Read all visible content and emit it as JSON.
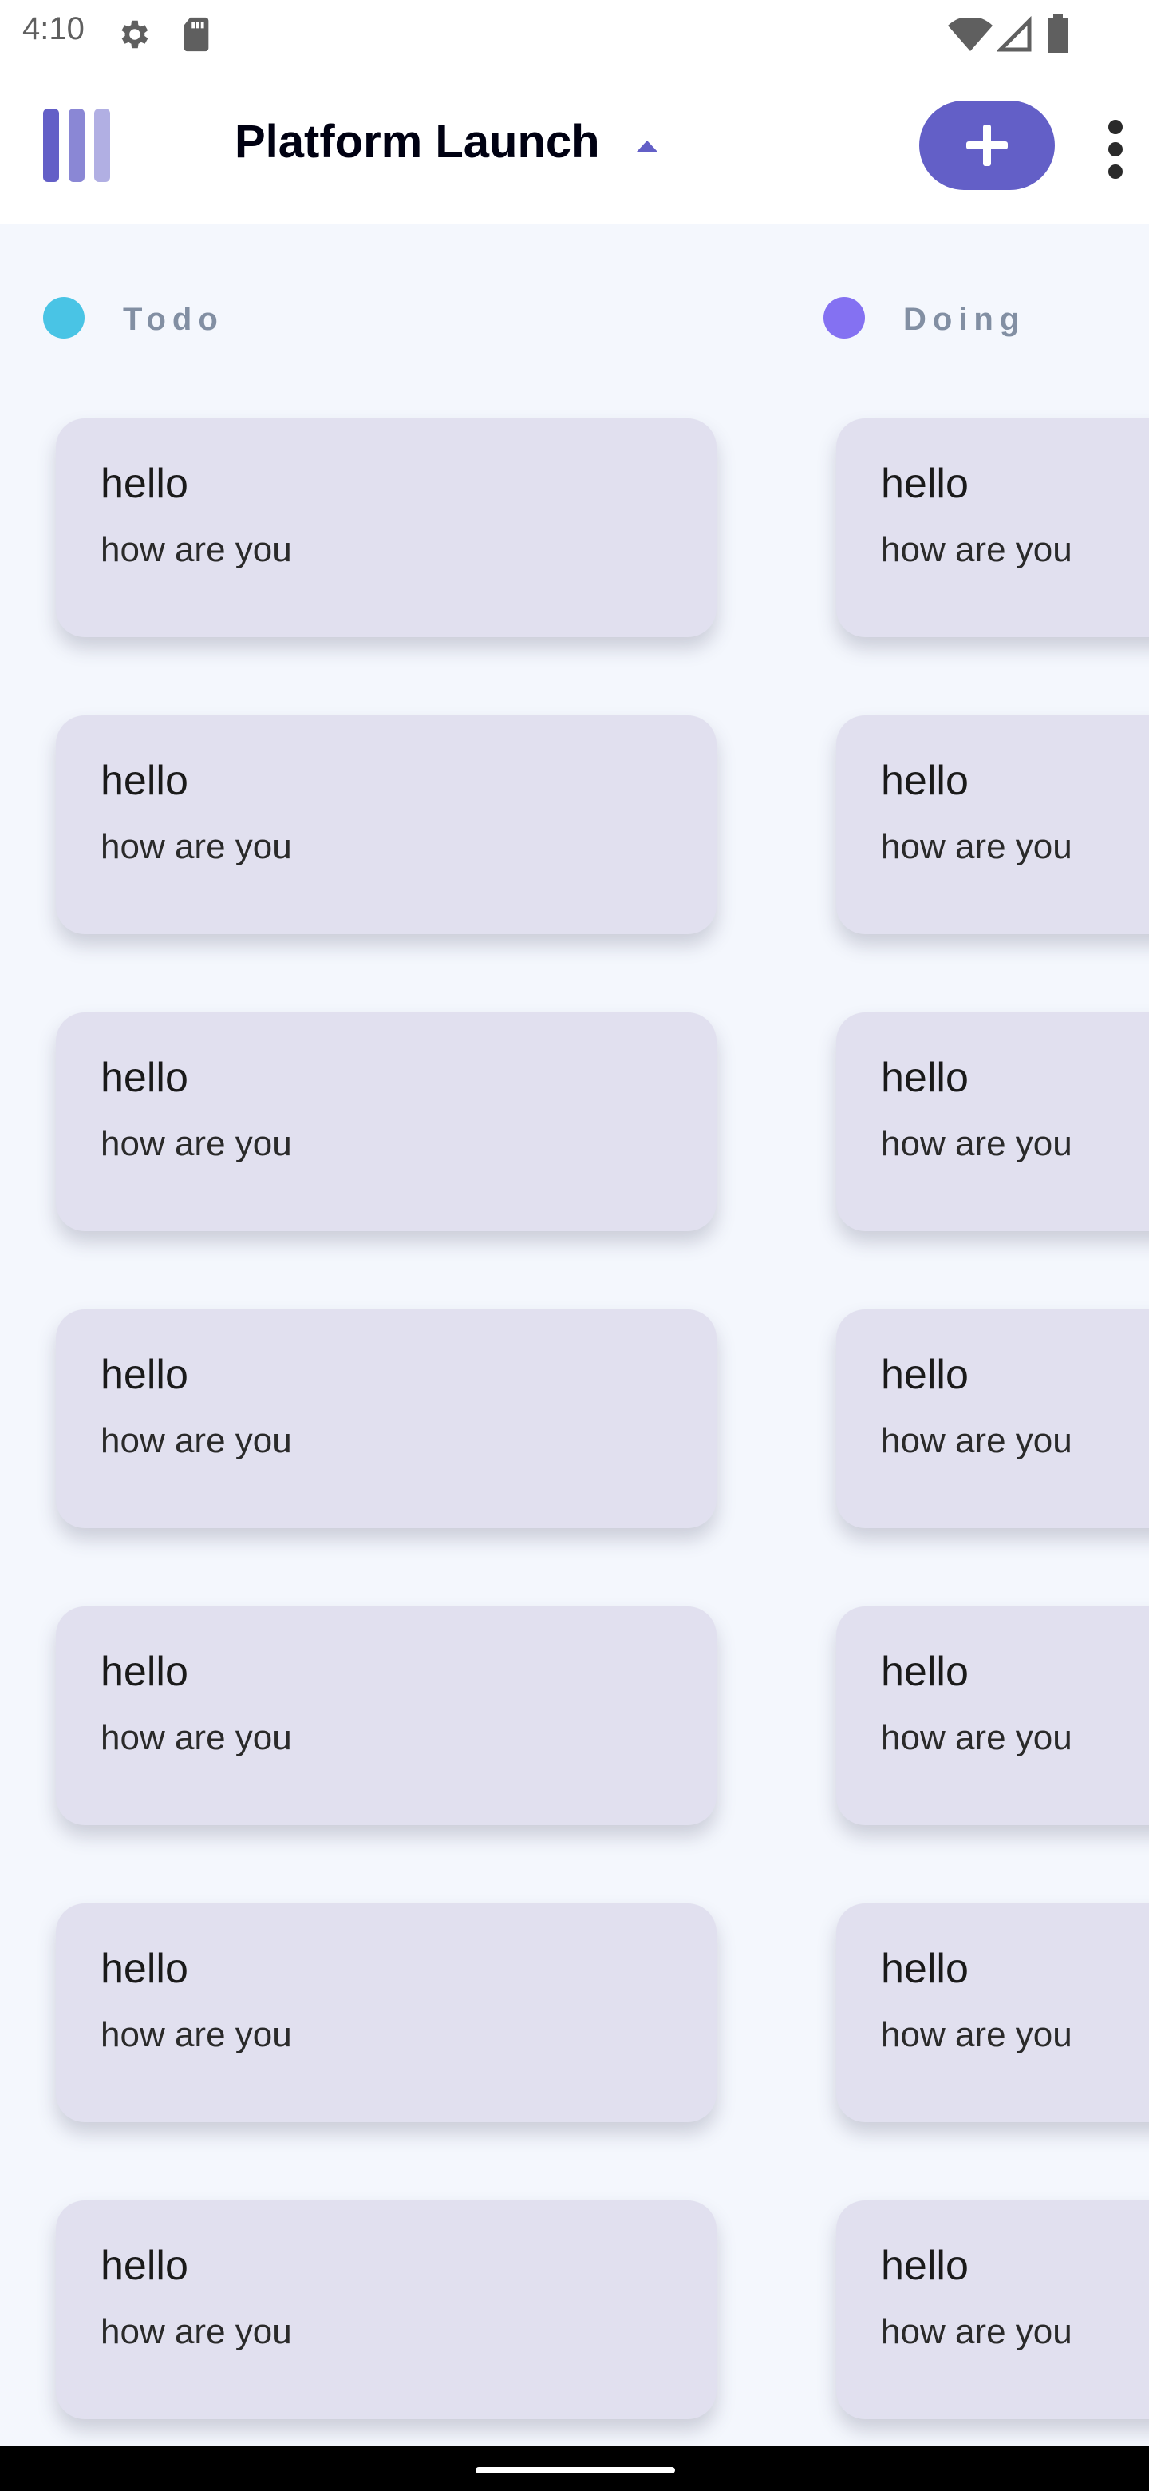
{
  "status_bar": {
    "time": "4:10",
    "left_icons": [
      "gear-icon",
      "sd-card-icon"
    ],
    "right_icons": [
      "wifi-icon",
      "cell-signal-icon",
      "battery-icon"
    ]
  },
  "app_bar": {
    "logo_icon": "kanban-logo-icon",
    "board_title": "Platform Launch",
    "dropdown_icon": "chevron-up-icon",
    "add_task_icon": "plus-icon",
    "more_icon": "more-vertical-icon"
  },
  "colors": {
    "accent": "#635fc7",
    "card_bg": "#e1e0ef",
    "board_bg": "#f4f7fd",
    "todo_dot": "#49c4e5",
    "doing_dot": "#8471f2",
    "column_label": "#828fa3"
  },
  "columns": [
    {
      "name": "Todo",
      "color": "#49c4e5",
      "tasks": [
        {
          "title": "hello",
          "description": "how are you"
        },
        {
          "title": "hello",
          "description": "how are you"
        },
        {
          "title": "hello",
          "description": "how are you"
        },
        {
          "title": "hello",
          "description": "how are you"
        },
        {
          "title": "hello",
          "description": "how are you"
        },
        {
          "title": "hello",
          "description": "how are you"
        },
        {
          "title": "hello",
          "description": "how are you"
        }
      ]
    },
    {
      "name": "Doing",
      "color": "#8471f2",
      "tasks": [
        {
          "title": "hello",
          "description": "how are you"
        },
        {
          "title": "hello",
          "description": "how are you"
        },
        {
          "title": "hello",
          "description": "how are you"
        },
        {
          "title": "hello",
          "description": "how are you"
        },
        {
          "title": "hello",
          "description": "how are you"
        },
        {
          "title": "hello",
          "description": "how are you"
        },
        {
          "title": "hello",
          "description": "how are you"
        }
      ]
    }
  ]
}
